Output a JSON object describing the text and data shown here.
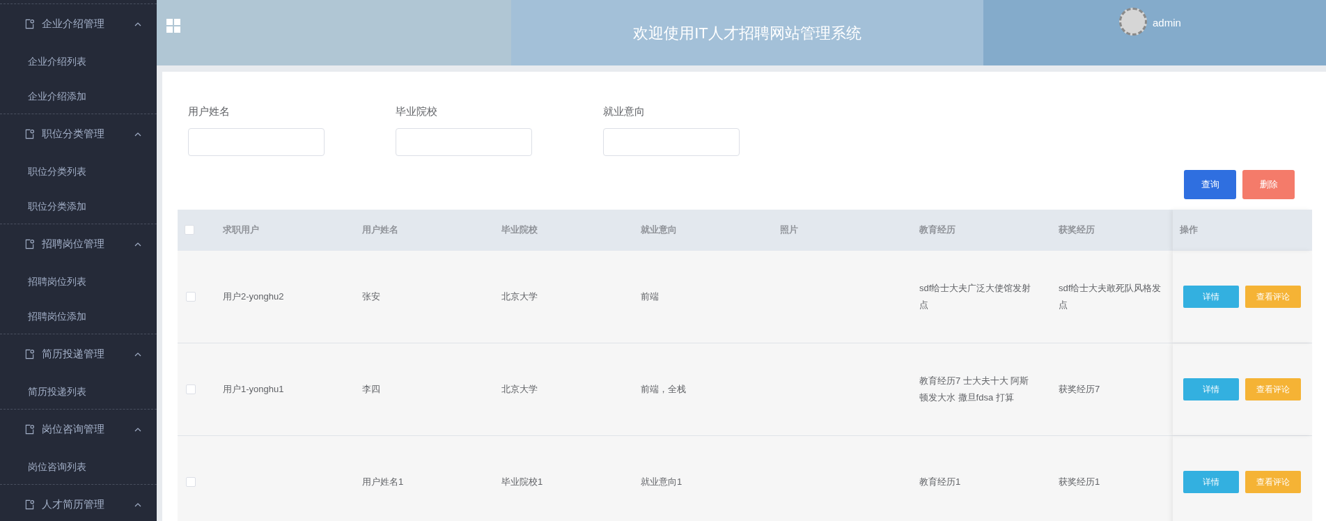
{
  "sidebar": {
    "groups": [
      {
        "label": "企业介绍管理",
        "expanded": true,
        "items": [
          "企业介绍列表",
          "企业介绍添加"
        ]
      },
      {
        "label": "职位分类管理",
        "expanded": true,
        "items": [
          "职位分类列表",
          "职位分类添加"
        ]
      },
      {
        "label": "招聘岗位管理",
        "expanded": true,
        "items": [
          "招聘岗位列表",
          "招聘岗位添加"
        ]
      },
      {
        "label": "简历投递管理",
        "expanded": true,
        "items": [
          "简历投递列表"
        ]
      },
      {
        "label": "岗位咨询管理",
        "expanded": true,
        "items": [
          "岗位咨询列表"
        ]
      },
      {
        "label": "人才简历管理",
        "expanded": true
      }
    ]
  },
  "header": {
    "title": "欢迎使用IT人才招聘网站管理系统",
    "user": "admin"
  },
  "filters": [
    {
      "label": "用户姓名"
    },
    {
      "label": "毕业院校"
    },
    {
      "label": "就业意向"
    }
  ],
  "actions": [
    {
      "label": "查询",
      "kind": "primary"
    },
    {
      "label": "删除",
      "kind": "danger"
    }
  ],
  "table": {
    "all_checked": false,
    "columns": [
      "求职用户",
      "用户姓名",
      "毕业院校",
      "就业意向",
      "照片",
      "教育经历",
      "获奖经历",
      "操作"
    ],
    "rows": [
      {
        "checked": false,
        "user": "用户2-yonghu2",
        "name": "张安",
        "school": "北京大学",
        "intent": "前端",
        "education": [
          "sdf给士大夫广泛大使馆发射",
          "点"
        ],
        "awards": [
          "sdf给士大夫敢死队风格发",
          "点"
        ],
        "buttons": [
          "详情",
          "查看评论"
        ]
      },
      {
        "checked": false,
        "user": "用户1-yonghu1",
        "name": "李四",
        "school": "北京大学",
        "intent": "前端，全栈",
        "education": [
          "教育经历7 士大夫十大 阿斯",
          "顿发大水 撒旦fdsa 打算"
        ],
        "awards": [
          "获奖经历7"
        ],
        "buttons": [
          "详情",
          "查看评论"
        ]
      },
      {
        "checked": false,
        "name": "用户姓名1",
        "school": "毕业院校1",
        "intent": "就业意向1",
        "education": [
          "教育经历1"
        ],
        "awards": [
          "获奖经历1"
        ],
        "buttons": [
          "详情",
          "查看评论"
        ]
      }
    ]
  }
}
